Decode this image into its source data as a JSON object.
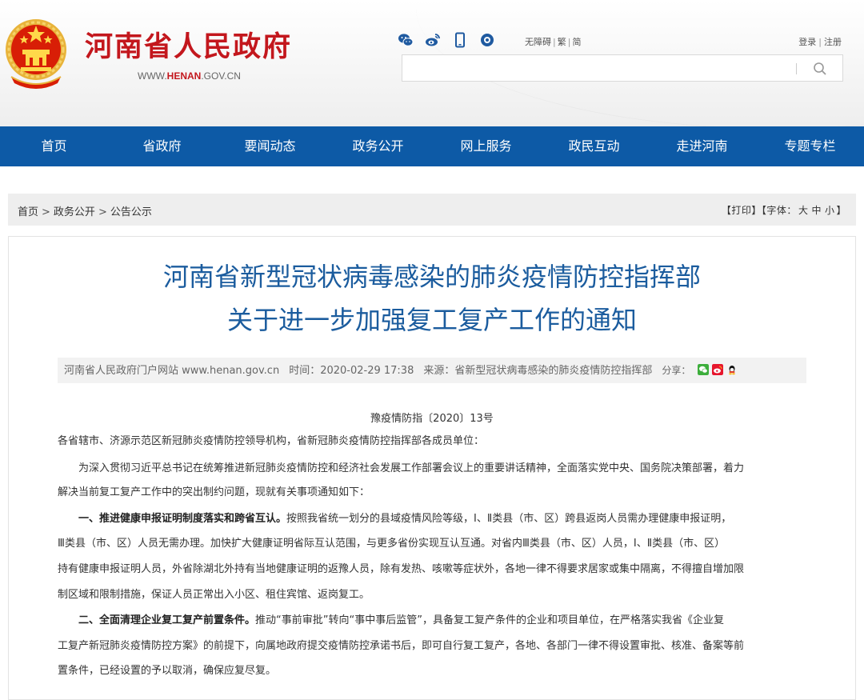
{
  "header": {
    "site_name": "河南省人民政府",
    "site_url_prefix": "WWW.",
    "site_url_brand": "HENAN",
    "site_url_suffix": ".GOV.CN",
    "icons": [
      "wechat-icon",
      "weibo-icon",
      "mobile-icon",
      "app-icon"
    ],
    "accessibility": [
      "无障碍",
      "繁",
      "简"
    ],
    "login": "登录",
    "register": "注册",
    "search": {
      "placeholder": "",
      "value": ""
    }
  },
  "nav": {
    "items": [
      "首页",
      "省政府",
      "要闻动态",
      "政务公开",
      "网上服务",
      "政民互动",
      "走进河南",
      "专题专栏"
    ]
  },
  "breadcrumb": {
    "items": [
      "首页",
      "政务公开",
      "公告公示"
    ],
    "separator": ">",
    "print": "【打印】",
    "font_prefix": "【字体：",
    "sizes": [
      "大",
      "中",
      "小"
    ],
    "font_suffix": "】"
  },
  "article": {
    "title_line1": "河南省新型冠状病毒感染的肺炎疫情防控指挥部",
    "title_line2": "关于进一步加强复工复产工作的通知",
    "meta": {
      "site": "河南省人民政府门户网站 www.henan.gov.cn",
      "time": "时间：2020-02-29 17:38",
      "source": "来源：省新型冠状病毒感染的肺炎疫情防控指挥部",
      "share_label": "分享："
    },
    "doc_number": "豫疫情防指〔2020〕13号",
    "addressee": "各省辖市、济源示范区新冠肺炎疫情防控领导机构，省新冠肺炎疫情防控指挥部各成员单位：",
    "intro_line1": "为深入贯彻习近平总书记在统筹推进新冠肺炎疫情防控和经济社会发展工作部署会议上的重要讲话精神，全面落实党中央、国务院决策部署，着力",
    "intro_line2": "解决当前复工复产工作中的突出制约问题，现就有关事项通知如下：",
    "s1_heading": "一、推进健康申报证明制度落实和跨省互认。",
    "s1_line1": "按照我省统一划分的县域疫情风险等级，Ⅰ、Ⅱ类县（市、区）跨县返岗人员需办理健康申报证明，",
    "s1_line2": "Ⅲ类县（市、区）人员无需办理。加快扩大健康证明省际互认范围，与更多省份实现互认互通。对省内Ⅲ类县（市、区）人员，Ⅰ、Ⅱ类县（市、区）",
    "s1_line3": "持有健康申报证明人员，外省除湖北外持有当地健康证明的返豫人员，除有发热、咳嗽等症状外，各地一律不得要求居家或集中隔离，不得擅自增加限",
    "s1_line4": "制区域和限制措施，保证人员正常出入小区、租住宾馆、返岗复工。",
    "s2_heading": "二、全面清理企业复工复产前置条件。",
    "s2_line1": "推动“事前审批”转向“事中事后监管”，具备复工复产条件的企业和项目单位，在严格落实我省《企业复",
    "s2_line2": "工复产新冠肺炎疫情防控方案》的前提下，向属地政府提交疫情防控承诺书后，即可自行复工复产，各地、各部门一律不得设置审批、核准、备案等前",
    "s2_line3": "置条件，已经设置的予以取消，确保应复尽复。"
  },
  "colors": {
    "brand_red": "#c3171d",
    "nav_blue": "#0d5aa6",
    "title_blue": "#1b5c9e"
  }
}
